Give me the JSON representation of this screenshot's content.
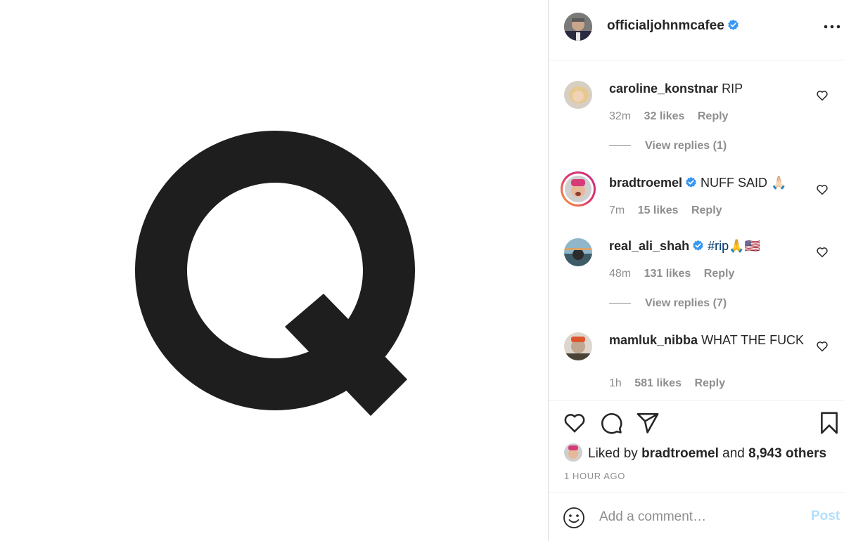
{
  "post": {
    "media_letter": "Q",
    "author": {
      "username": "officialjohnmcafee",
      "verified": true,
      "avatar_icon": "avatar"
    },
    "more_icon": "more-options-icon"
  },
  "comments": [
    {
      "username": "caroline_konstnar",
      "verified": false,
      "text": "RIP",
      "time": "32m",
      "likes": "32 likes",
      "reply_label": "Reply",
      "view_replies": "View replies (1)"
    },
    {
      "username": "bradtroemel",
      "verified": true,
      "text": "NUFF SAID 🙏🏻",
      "time": "7m",
      "likes": "15 likes",
      "reply_label": "Reply",
      "has_story_ring": true
    },
    {
      "username": "real_ali_shah",
      "verified": true,
      "text": "#rip",
      "text_suffix": "🙏🇺🇸",
      "time": "48m",
      "likes": "131 likes",
      "reply_label": "Reply",
      "view_replies": "View replies (7)"
    },
    {
      "username": "mamluk_nibba",
      "verified": false,
      "text": "WHAT THE FUCK",
      "time": "1h",
      "likes": "581 likes",
      "reply_label": "Reply"
    }
  ],
  "actions": {
    "liked_by_prefix": "Liked by",
    "liked_by_user": "bradtroemel",
    "liked_by_and": "and",
    "liked_by_others": "8,943 others",
    "timestamp": "1 HOUR AGO"
  },
  "add_comment": {
    "placeholder": "Add a comment…",
    "post_label": "Post"
  },
  "colors": {
    "verified_blue": "#3897f0",
    "muted_text": "#8e8e8e",
    "post_disabled": "#b2dffc",
    "hashtag": "#00376b"
  }
}
